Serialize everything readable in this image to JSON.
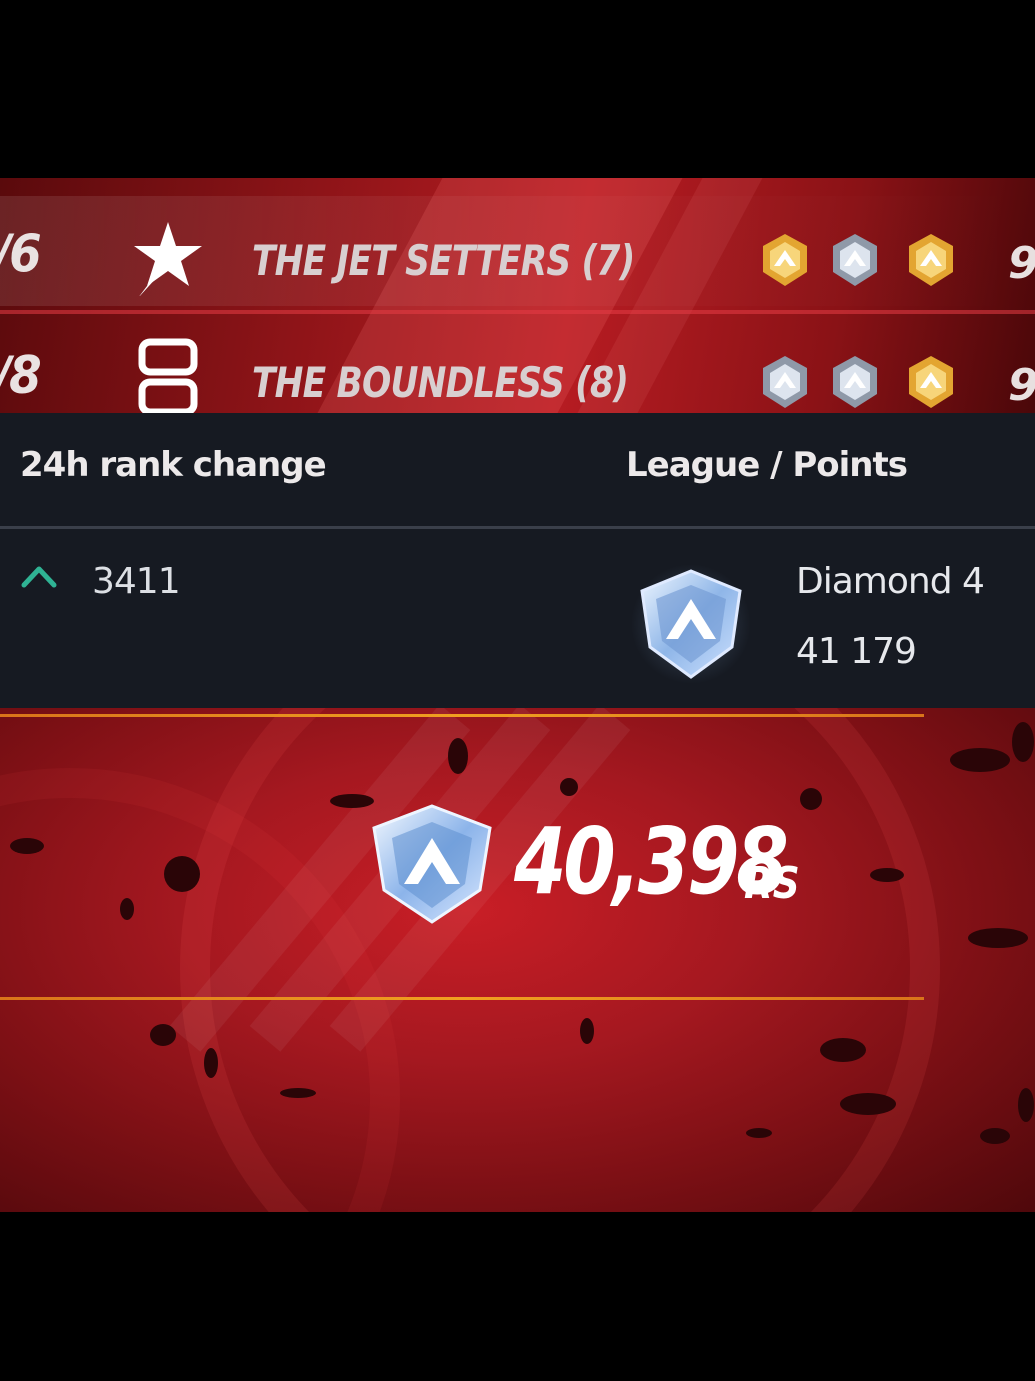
{
  "teams": [
    {
      "place": "/6",
      "icon": "star-icon",
      "name": "THE JET SETTERS (7)",
      "badges": [
        "gold-rank-badge",
        "silver-rank-badge",
        "gold-rank-badge"
      ],
      "score": "9"
    },
    {
      "place": "/8",
      "icon": "double-bar-icon",
      "name": "THE BOUNDLESS (8)",
      "badges": [
        "silver-rank-badge",
        "silver-rank-badge",
        "gold-rank-badge"
      ],
      "score": "9"
    }
  ],
  "stats": {
    "rank_change_header": "24h rank change",
    "league_header": "League / Points",
    "rank_change_value": "3411",
    "rank_change_direction": "up",
    "league_name": "Diamond 4",
    "league_points": "41 179",
    "league_icon": "diamond-league-icon"
  },
  "reward": {
    "amount": "40,398",
    "unit": "RS",
    "icon": "diamond-league-icon"
  },
  "colors": {
    "accent_red": "#b71c22",
    "panel_dark": "#161a22",
    "highlight_orange": "#f0a020",
    "rank_up_green": "#2fb394"
  }
}
